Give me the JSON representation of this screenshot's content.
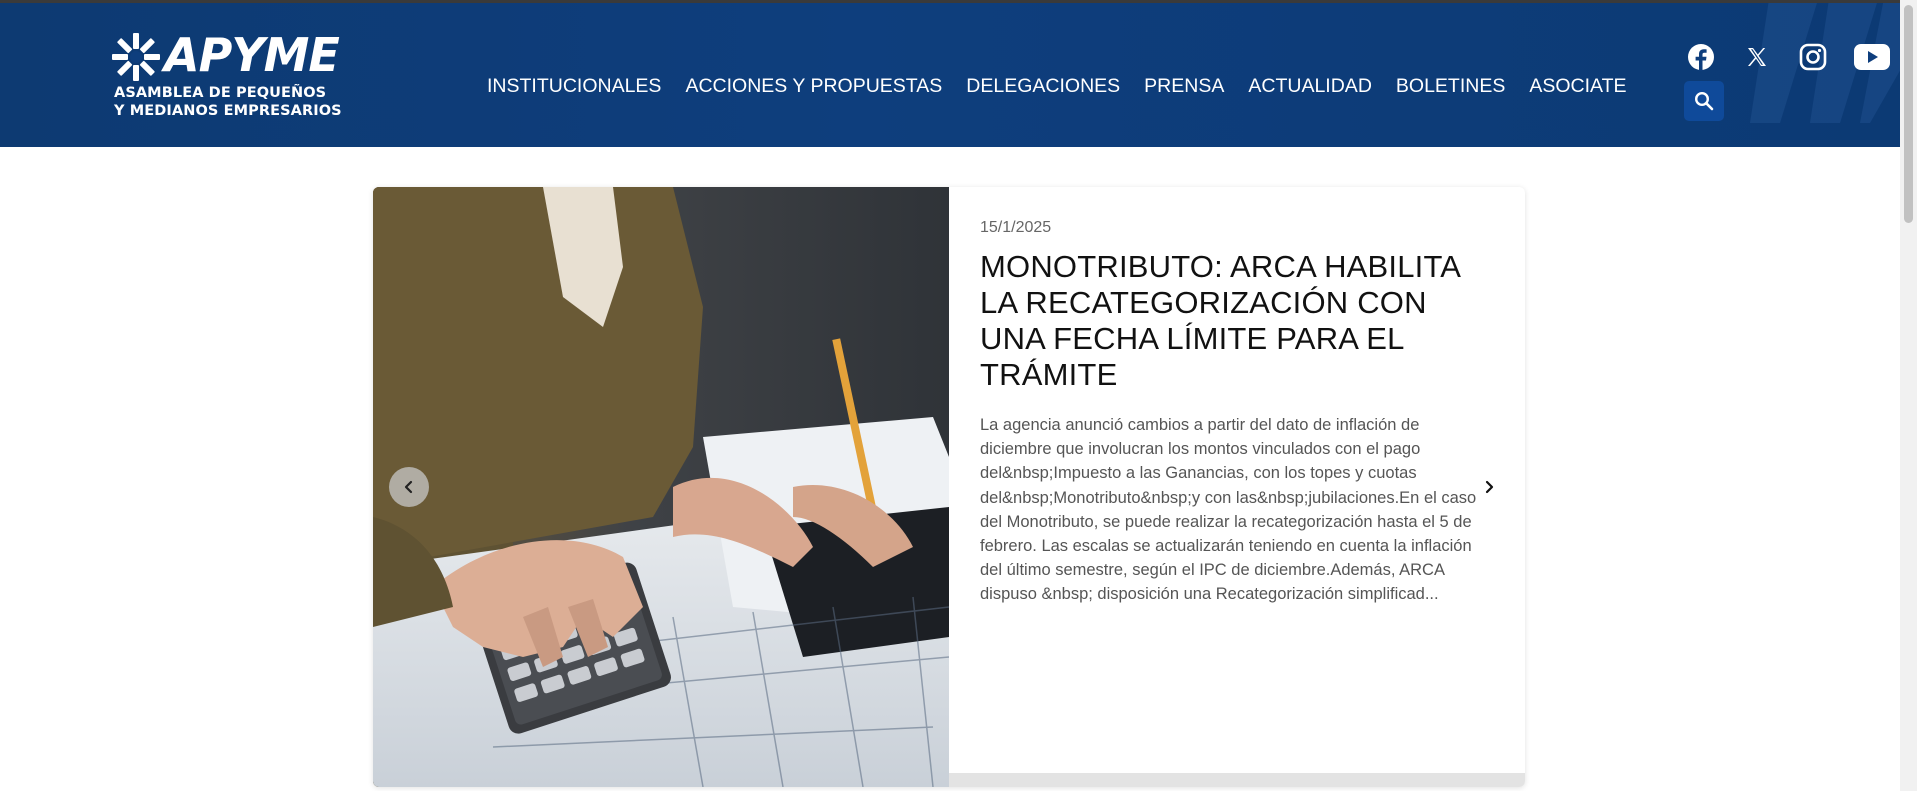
{
  "brand": {
    "name": "APYME",
    "subtitle_line1": "ASAMBLEA DE PEQUEÑOS",
    "subtitle_line2": "Y MEDIANOS EMPRESARIOS"
  },
  "nav": {
    "items": [
      {
        "label": "INSTITUCIONALES"
      },
      {
        "label": "ACCIONES Y PROPUESTAS"
      },
      {
        "label": "DELEGACIONES"
      },
      {
        "label": "PRENSA"
      },
      {
        "label": "ACTUALIDAD"
      },
      {
        "label": "BOLETINES"
      },
      {
        "label": "ASOCIATE"
      }
    ]
  },
  "social": [
    "facebook-icon",
    "x-twitter-icon",
    "instagram-icon",
    "youtube-icon"
  ],
  "colors": {
    "header_bg": "#0e3e7d",
    "search_button": "#0f4a9a",
    "headline": "#111111",
    "excerpt": "#555555"
  },
  "featured": {
    "date": "15/1/2025",
    "title": "MONOTRIBUTO: ARCA HABILITA LA RECATEGORIZACIÓN CON UNA FECHA LÍMITE PARA EL TRÁMITE",
    "excerpt": "La agencia anunció cambios a partir del dato de inflación de diciembre que involucran los montos vinculados con el pago del&nbsp;Impuesto a las Ganancias, con los topes y cuotas del&nbsp;Monotributo&nbsp;y con las&nbsp;jubilaciones.En el caso del Monotributo, se puede realizar la recategorización hasta el 5 de febrero. Las escalas se actualizarán teniendo en cuenta la inflación del último semestre, según el IPC de diciembre.Además, ARCA dispuso &nbsp; disposición una Recategorización simplificad..."
  }
}
